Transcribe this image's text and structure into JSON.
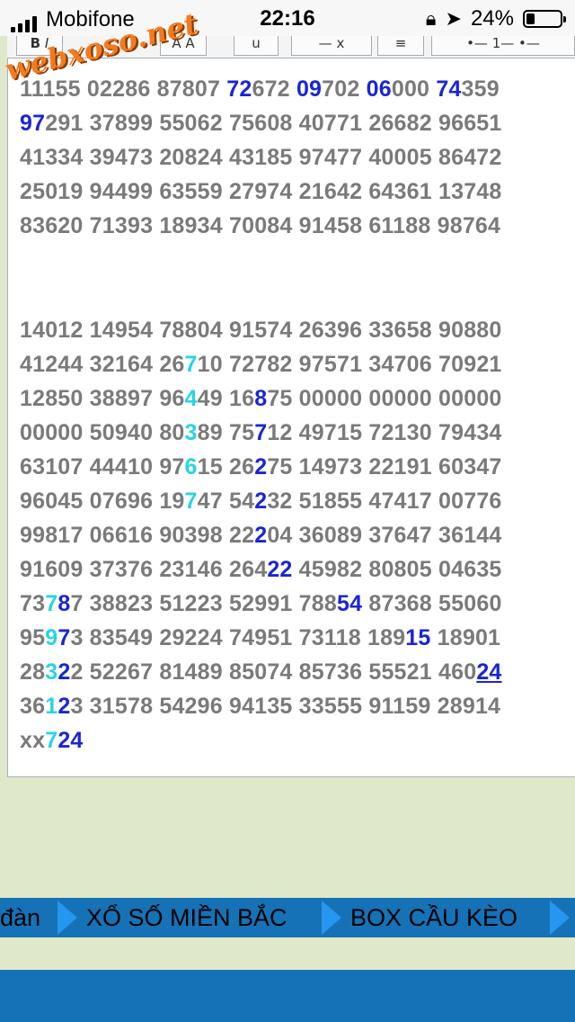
{
  "status_bar": {
    "carrier": "Mobifone",
    "time": "22:16",
    "battery": "24%"
  },
  "watermark": {
    "text": "webxoso.net"
  },
  "toolbar": {
    "buttons": [
      "B",
      "I",
      "A",
      "A",
      "u",
      "—",
      "x",
      "≡",
      "•—",
      "1—",
      "•—"
    ]
  },
  "lines": [
    [
      {
        "t": "11155 02286 87807 ",
        "c": "g"
      },
      {
        "t": "72",
        "c": "b"
      },
      {
        "t": "672 ",
        "c": "g"
      },
      {
        "t": "09",
        "c": "b"
      },
      {
        "t": "702 ",
        "c": "g"
      },
      {
        "t": "06",
        "c": "b"
      },
      {
        "t": "000 ",
        "c": "g"
      },
      {
        "t": "74",
        "c": "b"
      },
      {
        "t": "359",
        "c": "g"
      }
    ],
    [
      {
        "t": "97",
        "c": "b"
      },
      {
        "t": "291 37899 55062 75608 40771 26682 96651",
        "c": "g"
      }
    ],
    [
      {
        "t": "41334 39473 20824 43185 97477 40005 86472",
        "c": "g"
      }
    ],
    [
      {
        "t": "25019 94499 63559 27974 21642 64361 13748",
        "c": "g"
      }
    ],
    [
      {
        "t": "83620 71393 18934 70084 91458 61188 98764",
        "c": "g"
      }
    ],
    [
      {
        "t": "14012 14954 78804 91574 26396 33658 90880",
        "c": "g"
      }
    ],
    [
      {
        "t": "41244 32164 26",
        "c": "g"
      },
      {
        "t": "7",
        "c": "c"
      },
      {
        "t": "10 72782 97571 34706 70921",
        "c": "g"
      }
    ],
    [
      {
        "t": "12850 38897 96",
        "c": "g"
      },
      {
        "t": "4",
        "c": "c"
      },
      {
        "t": "49 16",
        "c": "g"
      },
      {
        "t": "8",
        "c": "b"
      },
      {
        "t": "75 00000 00000 00000",
        "c": "g"
      }
    ],
    [
      {
        "t": "00000 50940 80",
        "c": "g"
      },
      {
        "t": "3",
        "c": "c"
      },
      {
        "t": "89 75",
        "c": "g"
      },
      {
        "t": "7",
        "c": "b"
      },
      {
        "t": "12 49715 72130 79434",
        "c": "g"
      }
    ],
    [
      {
        "t": "63107 44410 97",
        "c": "g"
      },
      {
        "t": "6",
        "c": "c"
      },
      {
        "t": "15 26",
        "c": "g"
      },
      {
        "t": "2",
        "c": "b"
      },
      {
        "t": "75 14973 22191 60347",
        "c": "g"
      }
    ],
    [
      {
        "t": "96045 07696 19",
        "c": "g"
      },
      {
        "t": "7",
        "c": "c"
      },
      {
        "t": "47 54",
        "c": "g"
      },
      {
        "t": "2",
        "c": "b"
      },
      {
        "t": "32 51855 47417 00776",
        "c": "g"
      }
    ],
    [
      {
        "t": "99817 06616 90398 22",
        "c": "g"
      },
      {
        "t": "2",
        "c": "b"
      },
      {
        "t": "04 36089 37647 36144",
        "c": "g"
      }
    ],
    [
      {
        "t": "91609 37376 23146 264",
        "c": "g"
      },
      {
        "t": "22",
        "c": "b"
      },
      {
        "t": " 45982 80805 04635",
        "c": "g"
      }
    ],
    [
      {
        "t": "73",
        "c": "g"
      },
      {
        "t": "7",
        "c": "c"
      },
      {
        "t": "8",
        "c": "b"
      },
      {
        "t": "7 38823 51223 52991 788",
        "c": "g"
      },
      {
        "t": "54",
        "c": "b"
      },
      {
        "t": " 87368 55060",
        "c": "g"
      }
    ],
    [
      {
        "t": "95",
        "c": "g"
      },
      {
        "t": "9",
        "c": "c"
      },
      {
        "t": "7",
        "c": "b"
      },
      {
        "t": "3 83549 29224 74951 73118 189",
        "c": "g"
      },
      {
        "t": "15",
        "c": "b"
      },
      {
        "t": " 18901",
        "c": "g"
      }
    ],
    [
      {
        "t": "28",
        "c": "g"
      },
      {
        "t": "3",
        "c": "c"
      },
      {
        "t": "2",
        "c": "b"
      },
      {
        "t": "2 52267 81489 85074 85736 55521 460",
        "c": "g"
      },
      {
        "t": "24",
        "c": "bu"
      }
    ],
    [
      {
        "t": "36",
        "c": "g"
      },
      {
        "t": "1",
        "c": "c"
      },
      {
        "t": "2",
        "c": "b"
      },
      {
        "t": "3 31578 54296 94135 33555 91159 28914",
        "c": "g"
      }
    ],
    [
      {
        "t": "xx",
        "c": "g"
      },
      {
        "t": "7",
        "c": "c"
      },
      {
        "t": "24",
        "c": "b"
      }
    ]
  ],
  "nav": {
    "items": [
      "đàn",
      "XỔ SỐ MIỀN BẮC",
      "BOX CẦU KÈO"
    ]
  },
  "colors": {
    "gray_digits": "#7a7a7a",
    "blue_digits": "#1a25d6",
    "cyan_digits": "#27d4e3",
    "nav_bg": "#1672b6",
    "page_bg": "#dfe9c9"
  }
}
